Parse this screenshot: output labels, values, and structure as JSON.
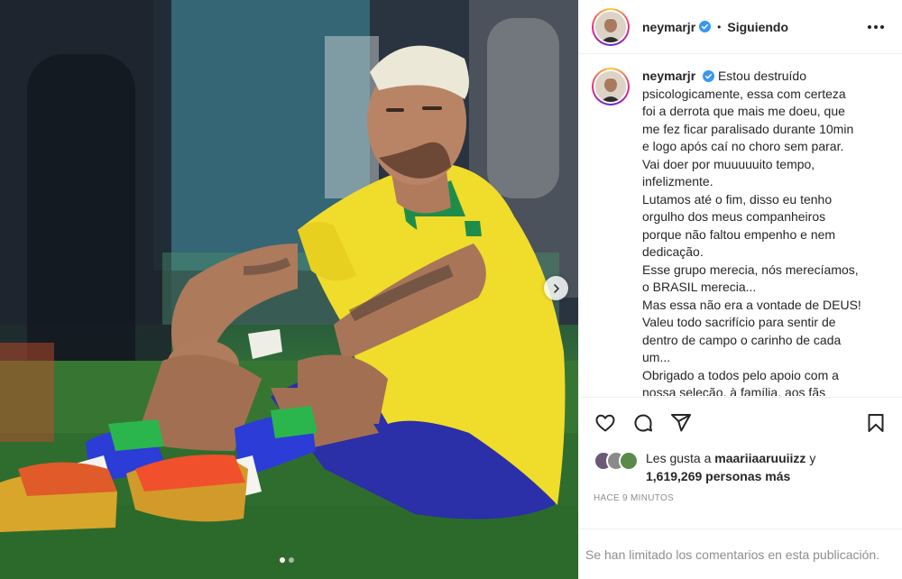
{
  "post": {
    "username": "neymarjr",
    "separator": "•",
    "follow_status": "Siguiendo",
    "photo_alt": "Neymar sentado en el césped",
    "carousel": {
      "count": 2,
      "active_index": 0
    }
  },
  "caption": {
    "username": "neymarjr",
    "lines": [
      "Estou destruído",
      "psicologicamente, essa com certeza",
      "foi a derrota que mais me doeu, que",
      "me fez ficar paralisado durante 10min",
      "e logo após caí no choro sem parar.",
      "Vai doer por muuuuuito tempo,",
      "infelizmente.",
      "Lutamos até o fim, disso eu tenho",
      "orgulho dos meus companheiros",
      "porque não faltou empenho e nem",
      "dedicação.",
      "Esse grupo merecia, nós merecíamos,",
      "o BRASIL merecia...",
      "Mas essa não era a vontade de DEUS!",
      "Valeu todo sacrifício para sentir de",
      "dentro de campo o carinho de cada",
      "um...",
      "Obrigado a todos pelo apoio com a",
      "nossa seleção, à família, aos fãs"
    ]
  },
  "likes": {
    "prefix": "Les gusta a",
    "first_user": "maariiaaruuiizz",
    "connector": "y",
    "count": "1,619,269 personas más"
  },
  "timestamp": "HACE 9 MINUTOS",
  "comments_notice": "Se han limitado los comentarios en esta publicación.",
  "colors": {
    "verified_blue": "#3897f0",
    "text": "#262626",
    "muted": "#8e8e8e",
    "jersey_yellow": "#f0dc2a",
    "shorts_blue": "#2b2fa8"
  },
  "icons": {
    "next": "chevron-right-icon",
    "like": "heart-icon",
    "comment": "comment-icon",
    "share": "paper-plane-icon",
    "save": "bookmark-icon",
    "more": "more-horizontal-icon",
    "verified": "verified-badge-icon"
  }
}
